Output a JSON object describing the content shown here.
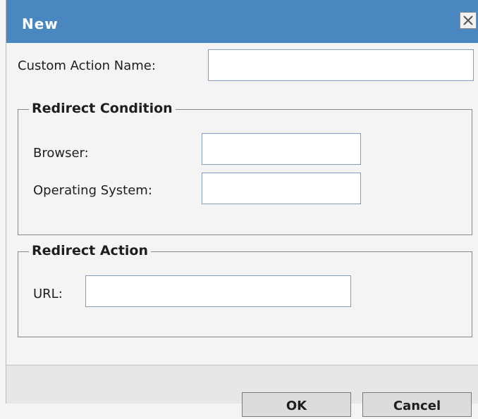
{
  "dialog": {
    "title": "New",
    "close_icon": "close-x-icon"
  },
  "form": {
    "custom_action_name": {
      "label": "Custom Action Name:",
      "value": ""
    },
    "redirect_condition": {
      "legend": "Redirect Condition",
      "browser": {
        "label": "Browser:",
        "value": ""
      },
      "operating_system": {
        "label": "Operating System:",
        "value": ""
      }
    },
    "redirect_action": {
      "legend": "Redirect Action",
      "url": {
        "label": "URL:",
        "value": ""
      }
    }
  },
  "buttons": {
    "ok": "OK",
    "cancel": "Cancel"
  },
  "colors": {
    "titlebar": "#4a86c0",
    "input_border": "#7f9db9",
    "background": "#f4f4f4"
  }
}
